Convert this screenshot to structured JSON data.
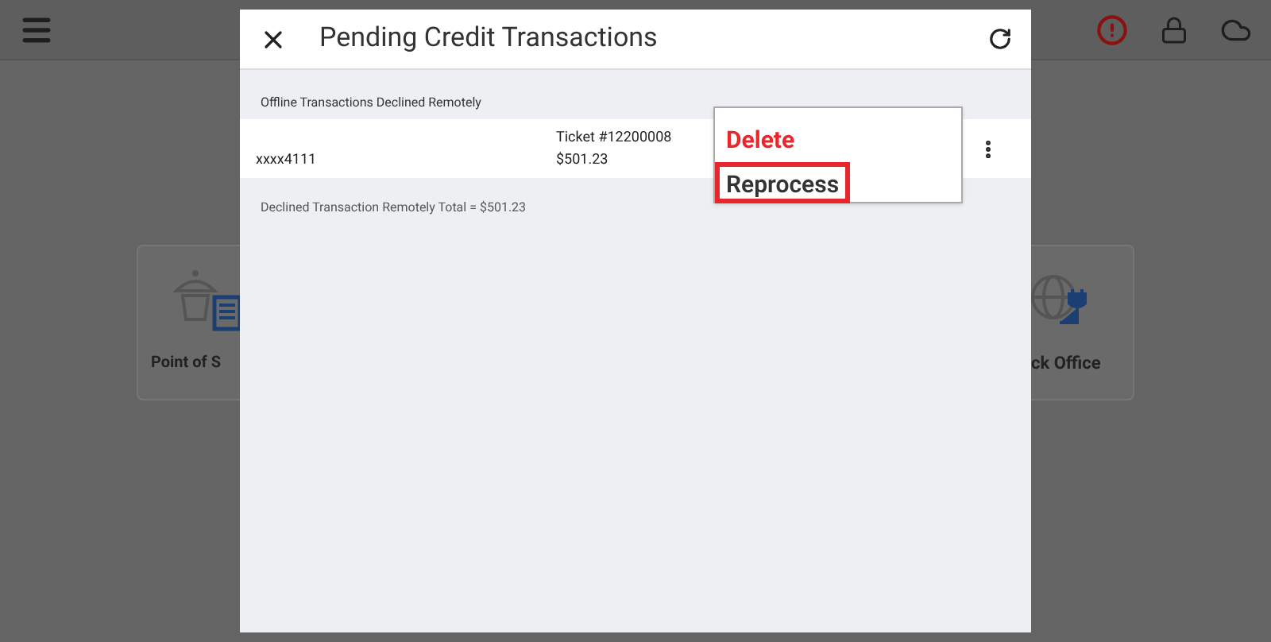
{
  "background": {
    "tiles": [
      {
        "label": "Point of S",
        "kind": "pos"
      },
      {
        "label": "ck Office",
        "kind": "office"
      }
    ],
    "alert": true
  },
  "dialog": {
    "title": "Pending Credit Transactions",
    "section": "Offline Transactions Declined Remotely",
    "rows": [
      {
        "card": "xxxx4111",
        "ticket": "Ticket #12200008",
        "amount": "$501.23"
      }
    ],
    "total": "Declined Transaction Remotely Total = $501.23",
    "menu": [
      {
        "label": "Delete",
        "kind": "danger",
        "highlighted": false
      },
      {
        "label": "Reprocess",
        "kind": "normal",
        "highlighted": true
      }
    ]
  }
}
